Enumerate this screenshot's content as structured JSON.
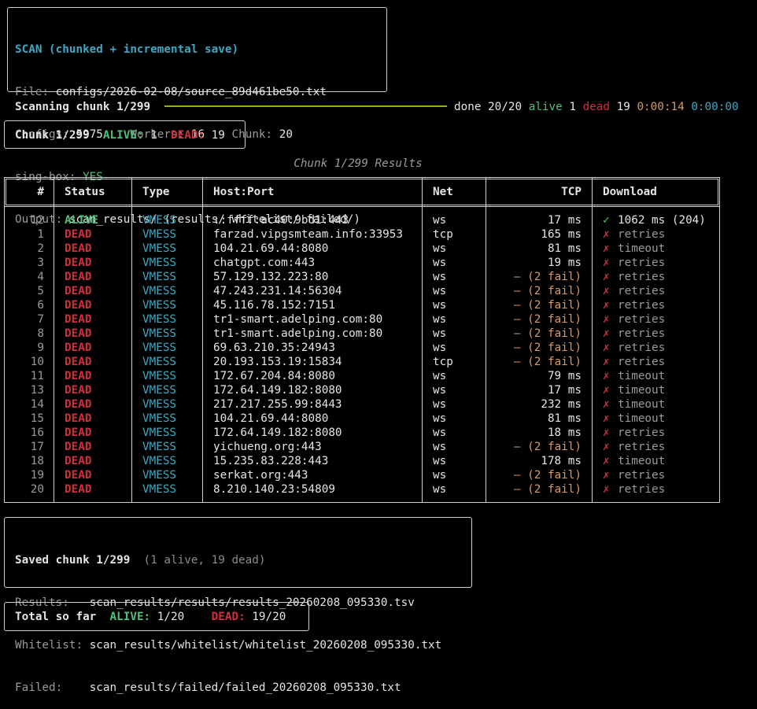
{
  "header": {
    "title": "SCAN (chunked + incremental save)",
    "file_label": "File:",
    "file_value": "configs/2026-02-08/source_89d461be50.txt",
    "configs_label": "Configs:",
    "configs_value": "5975",
    "workers_label": "Workers:",
    "workers_value": "16",
    "chunk_label": "Chunk:",
    "chunk_value": "20",
    "singbox_label": "sing-box:",
    "singbox_value": "YES",
    "output_label": "Output:",
    "output_value": "scan_results/ (results/ whitelist/ failed/)"
  },
  "progress": {
    "label": "Scanning chunk 1/299",
    "fraction": 1.0,
    "done_text": "done 20/20",
    "alive_label": "alive",
    "alive_value": "1",
    "dead_label": "dead",
    "dead_value": "19",
    "elapsed": "0:00:14",
    "remaining": "0:00:00",
    "colors": {
      "bar": "#8fb400"
    }
  },
  "chunk_summary": {
    "chunk": "Chunk 1/299",
    "alive_label": "ALIVE:",
    "alive_value": "1",
    "dead_label": "DEAD:",
    "dead_value": "19"
  },
  "results": {
    "caption": "Chunk 1/299 Results",
    "columns": [
      "#",
      "Status",
      "Type",
      "Host:Port",
      "Net",
      "TCP",
      "Download"
    ],
    "rows": [
      {
        "n": "12",
        "status": "ALIVE",
        "type": "VMESS",
        "host": "::ffff:ac40:9bd1:443",
        "net": "ws",
        "tcp": "17 ms",
        "dl_icon": "✓",
        "dl": "1062 ms (204)"
      },
      {
        "n": "1",
        "status": "DEAD",
        "type": "VMESS",
        "host": "farzad.vipgsmteam.info:33953",
        "net": "tcp",
        "tcp": "165 ms",
        "dl_icon": "✗",
        "dl": "retries"
      },
      {
        "n": "2",
        "status": "DEAD",
        "type": "VMESS",
        "host": "104.21.69.44:8080",
        "net": "ws",
        "tcp": "81 ms",
        "dl_icon": "✗",
        "dl": "timeout"
      },
      {
        "n": "3",
        "status": "DEAD",
        "type": "VMESS",
        "host": "chatgpt.com:443",
        "net": "ws",
        "tcp": "19 ms",
        "dl_icon": "✗",
        "dl": "retries"
      },
      {
        "n": "4",
        "status": "DEAD",
        "type": "VMESS",
        "host": "57.129.132.223:80",
        "net": "ws",
        "tcp": "— (2 fail)",
        "dl_icon": "✗",
        "dl": "retries"
      },
      {
        "n": "5",
        "status": "DEAD",
        "type": "VMESS",
        "host": "47.243.231.14:56304",
        "net": "ws",
        "tcp": "— (2 fail)",
        "dl_icon": "✗",
        "dl": "retries"
      },
      {
        "n": "6",
        "status": "DEAD",
        "type": "VMESS",
        "host": "45.116.78.152:7151",
        "net": "ws",
        "tcp": "— (2 fail)",
        "dl_icon": "✗",
        "dl": "retries"
      },
      {
        "n": "7",
        "status": "DEAD",
        "type": "VMESS",
        "host": "tr1-smart.adelping.com:80",
        "net": "ws",
        "tcp": "— (2 fail)",
        "dl_icon": "✗",
        "dl": "retries"
      },
      {
        "n": "8",
        "status": "DEAD",
        "type": "VMESS",
        "host": "tr1-smart.adelping.com:80",
        "net": "ws",
        "tcp": "— (2 fail)",
        "dl_icon": "✗",
        "dl": "retries"
      },
      {
        "n": "9",
        "status": "DEAD",
        "type": "VMESS",
        "host": "69.63.210.35:24943",
        "net": "ws",
        "tcp": "— (2 fail)",
        "dl_icon": "✗",
        "dl": "retries"
      },
      {
        "n": "10",
        "status": "DEAD",
        "type": "VMESS",
        "host": "20.193.153.19:15834",
        "net": "tcp",
        "tcp": "— (2 fail)",
        "dl_icon": "✗",
        "dl": "retries"
      },
      {
        "n": "11",
        "status": "DEAD",
        "type": "VMESS",
        "host": "172.67.204.84:8080",
        "net": "ws",
        "tcp": "79 ms",
        "dl_icon": "✗",
        "dl": "timeout"
      },
      {
        "n": "13",
        "status": "DEAD",
        "type": "VMESS",
        "host": "172.64.149.182:8080",
        "net": "ws",
        "tcp": "17 ms",
        "dl_icon": "✗",
        "dl": "timeout"
      },
      {
        "n": "14",
        "status": "DEAD",
        "type": "VMESS",
        "host": "217.217.255.99:8443",
        "net": "ws",
        "tcp": "232 ms",
        "dl_icon": "✗",
        "dl": "timeout"
      },
      {
        "n": "15",
        "status": "DEAD",
        "type": "VMESS",
        "host": "104.21.69.44:8080",
        "net": "ws",
        "tcp": "81 ms",
        "dl_icon": "✗",
        "dl": "timeout"
      },
      {
        "n": "16",
        "status": "DEAD",
        "type": "VMESS",
        "host": "172.64.149.182:8080",
        "net": "ws",
        "tcp": "18 ms",
        "dl_icon": "✗",
        "dl": "retries"
      },
      {
        "n": "17",
        "status": "DEAD",
        "type": "VMESS",
        "host": "yichueng.org:443",
        "net": "ws",
        "tcp": "— (2 fail)",
        "dl_icon": "✗",
        "dl": "retries"
      },
      {
        "n": "18",
        "status": "DEAD",
        "type": "VMESS",
        "host": "15.235.83.228:443",
        "net": "ws",
        "tcp": "178 ms",
        "dl_icon": "✗",
        "dl": "timeout"
      },
      {
        "n": "19",
        "status": "DEAD",
        "type": "VMESS",
        "host": "serkat.org:443",
        "net": "ws",
        "tcp": "— (2 fail)",
        "dl_icon": "✗",
        "dl": "retries"
      },
      {
        "n": "20",
        "status": "DEAD",
        "type": "VMESS",
        "host": "8.210.140.23:54809",
        "net": "ws",
        "tcp": "— (2 fail)",
        "dl_icon": "✗",
        "dl": "retries"
      }
    ]
  },
  "saved": {
    "title": "Saved chunk 1/299",
    "summary": "(1 alive, 19 dead)",
    "results_label": "Results:",
    "results_path": "scan_results/results/results_20260208_095330.tsv",
    "whitelist_label": "Whitelist:",
    "whitelist_path": "scan_results/whitelist/whitelist_20260208_095330.txt",
    "failed_label": "Failed:",
    "failed_path": "scan_results/failed/failed_20260208_095330.txt"
  },
  "total": {
    "label": "Total so far",
    "alive_label": "ALIVE:",
    "alive_value": "1/20",
    "dead_label": "DEAD:",
    "dead_value": "19/20"
  }
}
